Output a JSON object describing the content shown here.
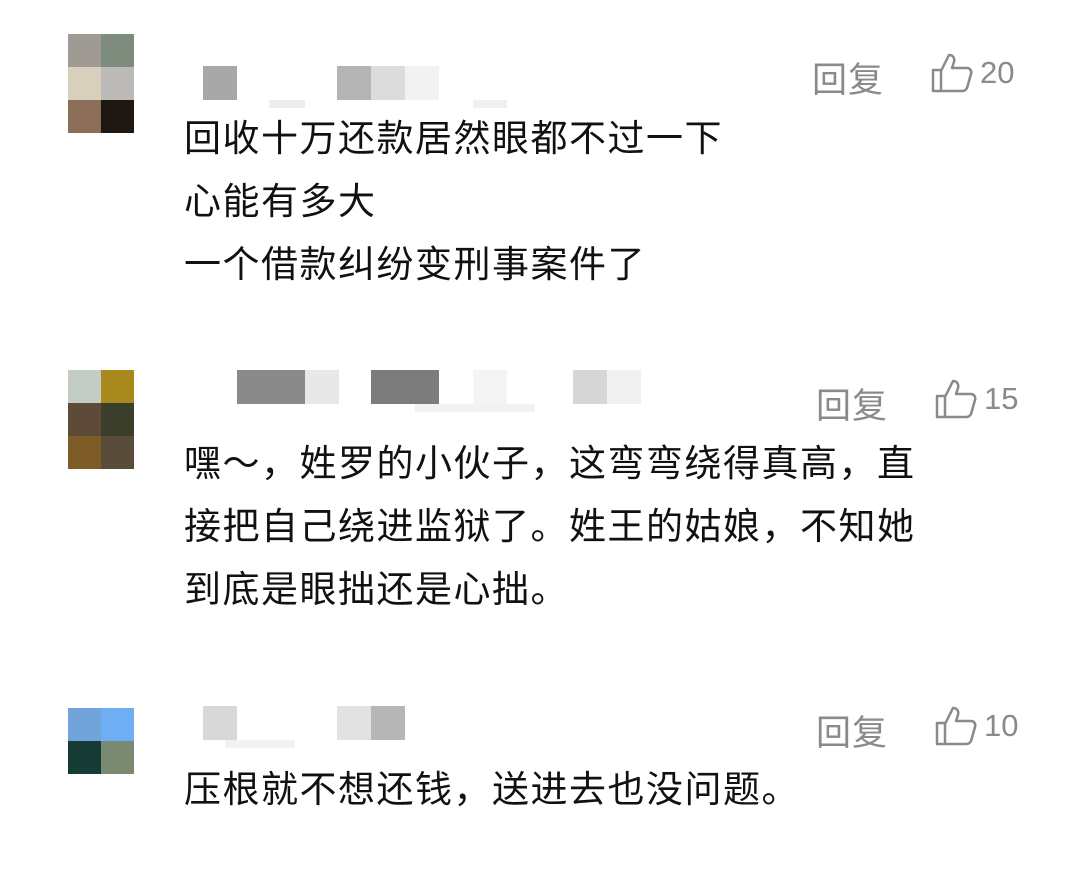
{
  "comments": [
    {
      "reply_label": "回复",
      "like_count": "20",
      "lines": [
        "回收十万还款居然眼都不过一下",
        "心能有多大",
        "一个借款纠纷变刑事案件了"
      ],
      "avatar_colors": [
        "#a09a94",
        "#7e8c7e",
        "#d8d0bc",
        "#bcbab6",
        "#8c6e58",
        "#1e1712"
      ]
    },
    {
      "reply_label": "回复",
      "like_count": "15",
      "lines": [
        "嘿～，姓罗的小伙子，这弯弯绕得真高，直",
        "接把自己绕进监狱了。姓王的姑娘，不知她",
        "到底是眼拙还是心拙。"
      ],
      "avatar_colors": [
        "#c4ccc6",
        "#a88a1c",
        "#5e4a38",
        "#3a3e2a",
        "#7e5c28",
        "#5a4c3a"
      ]
    },
    {
      "reply_label": "回复",
      "like_count": "10",
      "lines": [
        "压根就不想还钱，送进去也没问题。"
      ],
      "avatar_colors": [
        "#72a4dc",
        "#6eaef4",
        "#163a34",
        "#7a8a72"
      ]
    }
  ]
}
